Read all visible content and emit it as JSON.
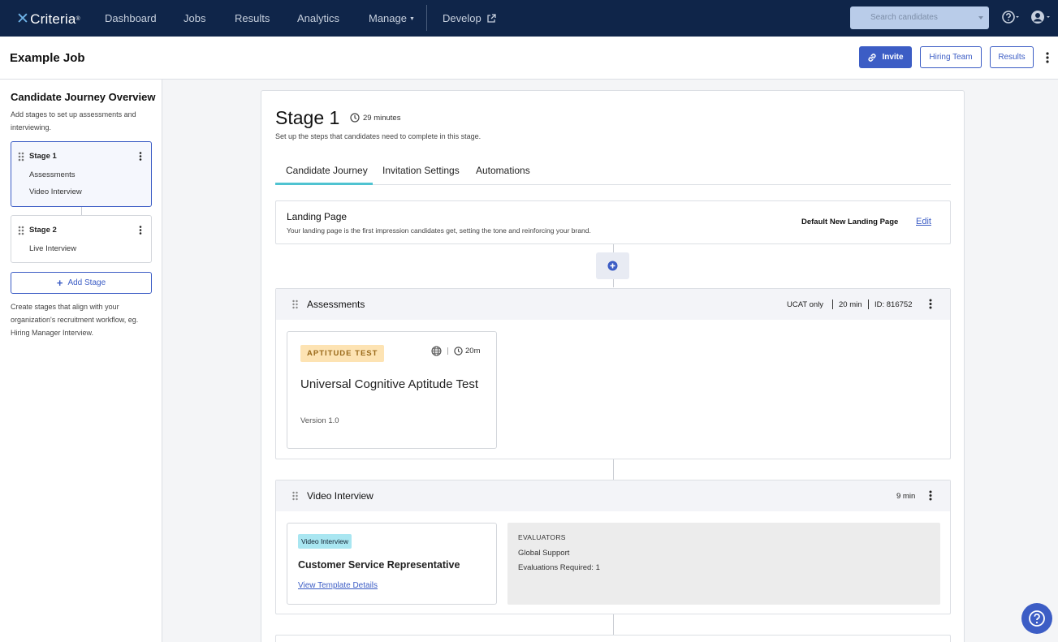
{
  "nav": {
    "logo": "Criteria",
    "logo_mark": "®",
    "items": [
      "Dashboard",
      "Jobs",
      "Results",
      "Analytics",
      "Manage",
      "Develop"
    ],
    "search_placeholder": "Search candidates"
  },
  "header": {
    "title": "Example Job",
    "invite": "Invite",
    "hiring_team": "Hiring Team",
    "results": "Results"
  },
  "sidebar": {
    "title": "Candidate Journey Overview",
    "description": "Add stages to set up assessments and interviewing.",
    "stages": [
      {
        "name": "Stage 1",
        "items": [
          "Assessments",
          "Video Interview"
        ]
      },
      {
        "name": "Stage 2",
        "items": [
          "Live Interview"
        ]
      }
    ],
    "add_stage": "Add Stage",
    "footer": "Create stages that align with your organization's recruitment workflow, eg. Hiring Manager Interview."
  },
  "main": {
    "stage_title": "Stage 1",
    "duration": "29 minutes",
    "description": "Set up the steps that candidates need to complete in this stage.",
    "tabs": [
      "Candidate Journey",
      "Invitation Settings",
      "Automations"
    ],
    "landing": {
      "title": "Landing Page",
      "description": "Your landing page is the first impression candidates get, setting the tone and reinforcing your brand.",
      "name": "Default New Landing Page",
      "edit": "Edit"
    },
    "assessments": {
      "title": "Assessments",
      "meta": [
        "UCAT only",
        "20 min",
        "ID: 816752"
      ],
      "card": {
        "badge": "APTITUDE TEST",
        "time": "20m",
        "name": "Universal Cognitive Aptitude Test",
        "version": "Version 1.0"
      }
    },
    "video": {
      "title": "Video Interview",
      "time": "9 min",
      "card": {
        "badge": "Video Interview",
        "name": "Customer Service Representative",
        "link": "View Template Details"
      },
      "evaluators": {
        "label": "EVALUATORS",
        "group": "Global Support",
        "required": "Evaluations Required: 1"
      }
    }
  },
  "colors": {
    "nav_bg": "#0f2549",
    "primary": "#3c5dc5",
    "tab_accent": "#4fc3d1",
    "aptitude_badge": "#fde3b3",
    "video_badge": "#a9e6f1"
  }
}
